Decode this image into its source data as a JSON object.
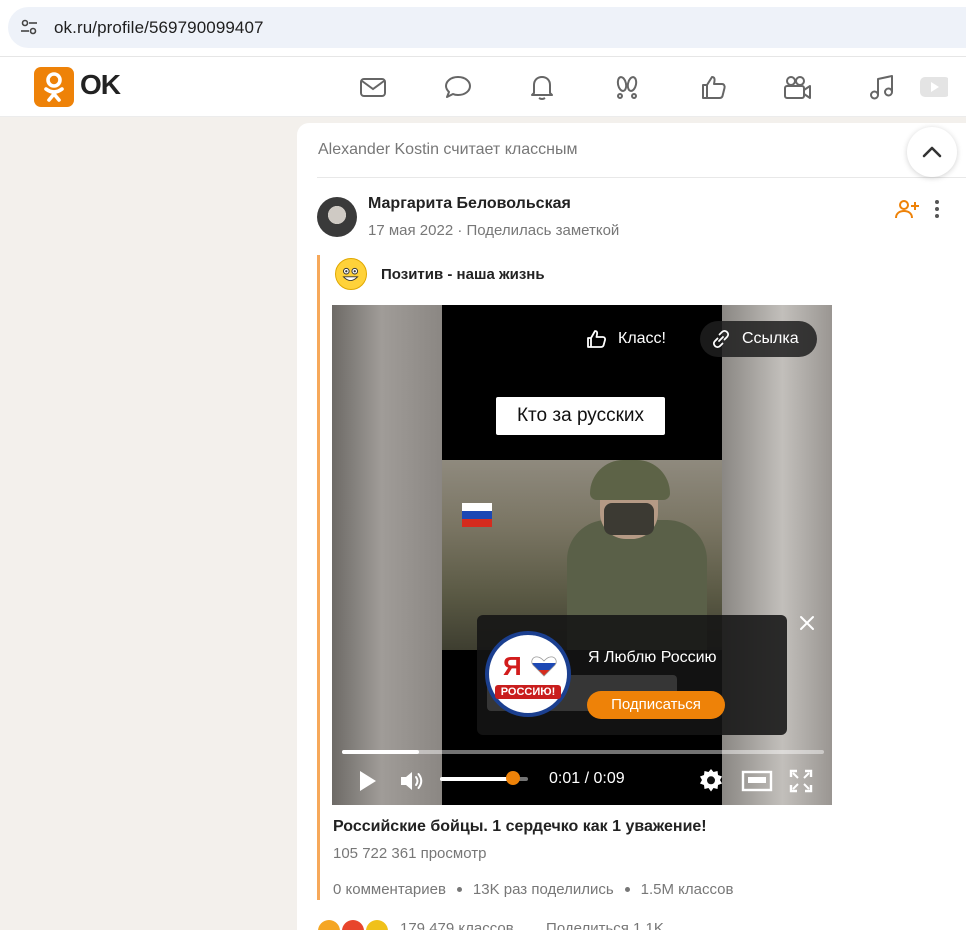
{
  "browser": {
    "url": "ok.ru/profile/569790099407"
  },
  "header": {
    "logo_text": "OK",
    "nav_icons": [
      "mail-icon",
      "chat-icon",
      "bell-icon",
      "events-icon",
      "like-icon",
      "video-camera-icon",
      "music-icon",
      "video-icon"
    ]
  },
  "feed": {
    "liked_by": "Alexander Kostin считает классным",
    "author": "Маргарита Беловольская",
    "date": "17 мая 2022",
    "meta_sep": "·",
    "action": "Поделилась заметкой",
    "group": "Позитив - наша жизнь",
    "video": {
      "overlay_title": "Кто за русских",
      "klass_label": "Класс!",
      "link_label": "Ссылка",
      "popup_channel": "Я Люблю Россию",
      "popup_logo_ya": "Я",
      "popup_logo_text": "РОССИЮ!",
      "subscribe_label": "Подписаться",
      "time": "0:01 / 0:09",
      "progress_fraction": 0.16,
      "volume_fraction": 0.83
    },
    "caption": "Российские бойцы. 1 сердечко как 1 уважение!",
    "views": "105 722 361 просмотр",
    "stats": {
      "comments": "0 комментариев",
      "shares": "13K раз поделились",
      "classes": "1.5M классов"
    },
    "bottom": {
      "reactions_count": "179 479 классов",
      "shares": "Поделиться 1.1K"
    }
  },
  "colors": {
    "ok_orange": "#ee8208",
    "accent_line": "#f6a85a"
  }
}
